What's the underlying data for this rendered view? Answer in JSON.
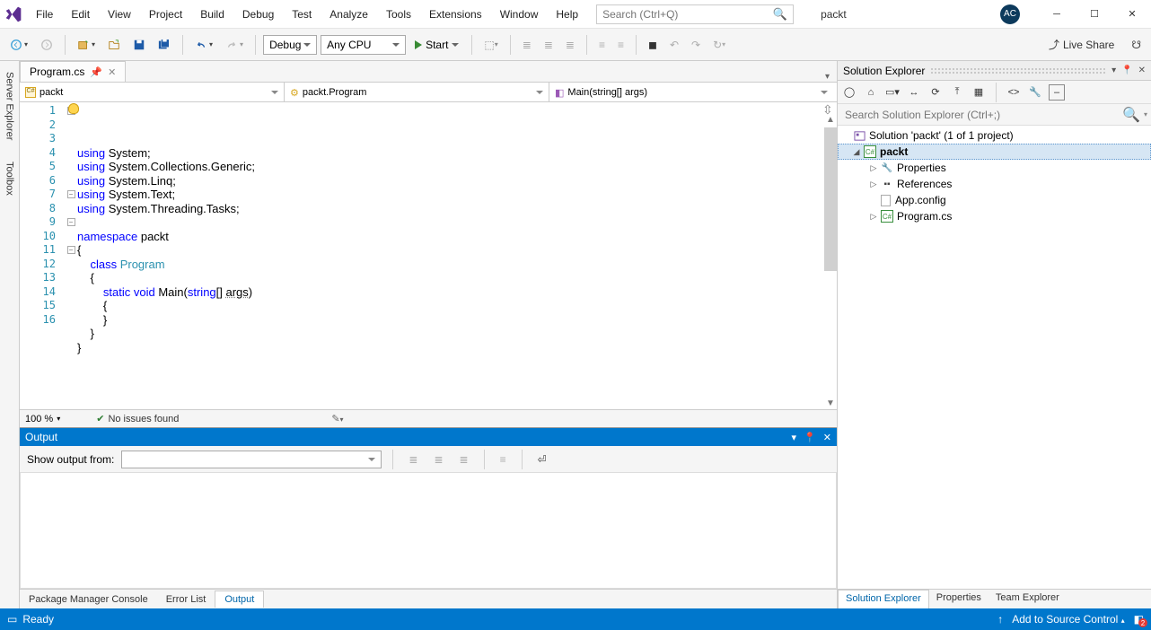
{
  "menu": [
    "File",
    "Edit",
    "View",
    "Project",
    "Build",
    "Debug",
    "Test",
    "Analyze",
    "Tools",
    "Extensions",
    "Window",
    "Help"
  ],
  "search_placeholder": "Search (Ctrl+Q)",
  "project_name": "packt",
  "avatar_initials": "AC",
  "toolbar": {
    "config_dropdown": "Debug",
    "platform_dropdown": "Any CPU",
    "start_label": "Start",
    "live_share": "Live Share"
  },
  "side_tabs": [
    "Server Explorer",
    "Toolbox"
  ],
  "doc_tab": {
    "name": "Program.cs"
  },
  "breadcrumbs": {
    "scope": "packt",
    "class": "packt.Program",
    "member": "Main(string[] args)"
  },
  "code_lines": [
    {
      "n": 1,
      "fold": "⊟",
      "html": "<span class='kw'>using</span> System;"
    },
    {
      "n": 2,
      "fold": "",
      "html": "<span class='kw'>using</span> System.Collections.Generic;"
    },
    {
      "n": 3,
      "fold": "",
      "html": "<span class='kw'>using</span> System.Linq;"
    },
    {
      "n": 4,
      "fold": "",
      "html": "<span class='kw'>using</span> System.Text;"
    },
    {
      "n": 5,
      "fold": "",
      "html": "<span class='kw'>using</span> System.Threading.Tasks;"
    },
    {
      "n": 6,
      "fold": "",
      "html": ""
    },
    {
      "n": 7,
      "fold": "⊟",
      "html": "<span class='kw'>namespace</span> <span class='id'>packt</span>"
    },
    {
      "n": 8,
      "fold": "",
      "html": "{"
    },
    {
      "n": 9,
      "fold": "⊟",
      "html": "    <span class='kw'>class</span> <span class='typ'>Program</span>"
    },
    {
      "n": 10,
      "fold": "",
      "html": "    {"
    },
    {
      "n": 11,
      "fold": "⊟",
      "html": "        <span class='kw'>static</span> <span class='kw'>void</span> Main(<span class='kw'>string</span>[] <span style='text-decoration:underline dotted #888'>args</span>)"
    },
    {
      "n": 12,
      "fold": "",
      "html": "        {"
    },
    {
      "n": 13,
      "fold": "",
      "html": "        }"
    },
    {
      "n": 14,
      "fold": "",
      "html": "    }"
    },
    {
      "n": 15,
      "fold": "",
      "html": "}"
    },
    {
      "n": 16,
      "fold": "",
      "html": ""
    }
  ],
  "editor_status": {
    "zoom": "100 %",
    "issues": "No issues found"
  },
  "output": {
    "title": "Output",
    "show_from_label": "Show output from:"
  },
  "bottom_tabs": [
    "Package Manager Console",
    "Error List",
    "Output"
  ],
  "solexp": {
    "title": "Solution Explorer",
    "search_placeholder": "Search Solution Explorer (Ctrl+;)",
    "solution_label": "Solution 'packt' (1 of 1 project)",
    "project": "packt",
    "nodes": [
      "Properties",
      "References",
      "App.config",
      "Program.cs"
    ],
    "bottom_tabs": [
      "Solution Explorer",
      "Properties",
      "Team Explorer"
    ]
  },
  "statusbar": {
    "ready": "Ready",
    "source_control": "Add to Source Control",
    "notif_count": "2"
  }
}
